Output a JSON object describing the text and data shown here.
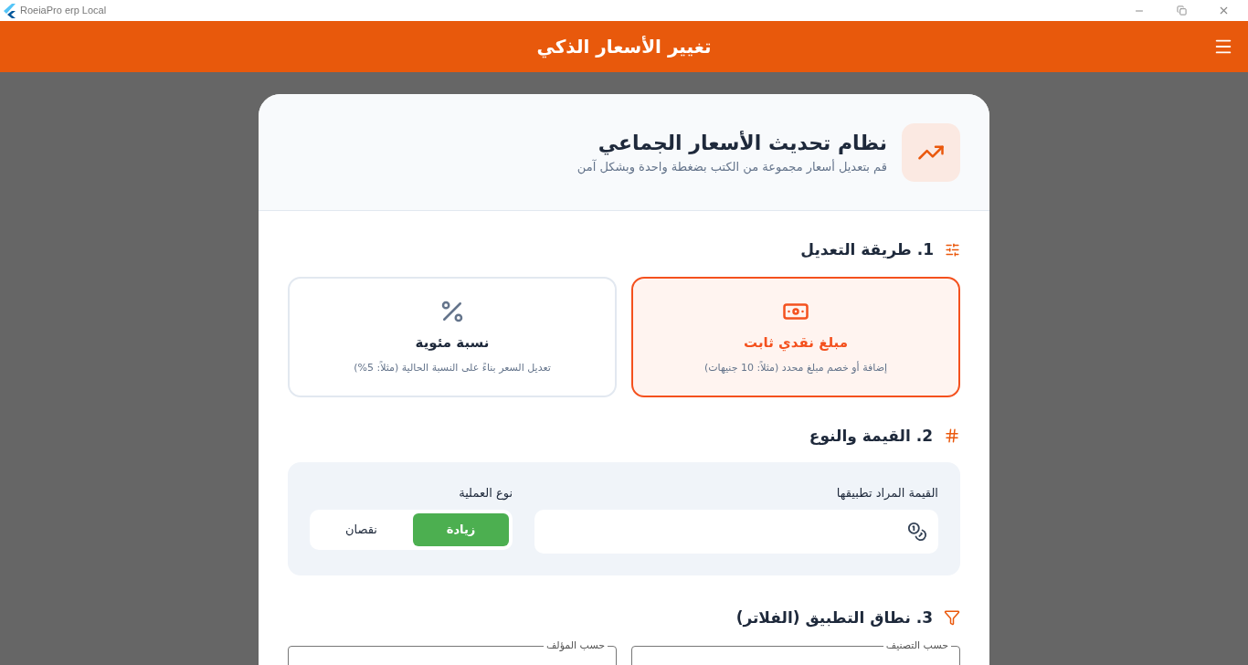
{
  "window": {
    "title": "RoeiaPro erp Local"
  },
  "app_bar": {
    "title": "تغيير الأسعار الذكي"
  },
  "header": {
    "title": "نظام تحديث الأسعار الجماعي",
    "subtitle": "قم بتعديل أسعار مجموعة من الكتب بضغطة واحدة وبشكل آمن"
  },
  "method_section": {
    "title": "1. طريقة التعديل",
    "options": [
      {
        "kind": "cash",
        "title": "مبلغ نقدي ثابت",
        "description": "إضافة أو خصم مبلغ محدد (مثلاً: 10 جنيهات)",
        "selected": true
      },
      {
        "kind": "percent",
        "title": "نسبة مئوية",
        "description": "تعديل السعر بناءً على النسبة الحالية (مثلاً: 5%)",
        "selected": false
      }
    ]
  },
  "value_section": {
    "title": "2. القيمة والنوع",
    "value_label": "القيمة المراد تطبيقها",
    "operation_label": "نوع العملية",
    "operations": [
      {
        "label": "زيادة",
        "selected": true
      },
      {
        "label": "نقصان",
        "selected": false
      }
    ]
  },
  "filter_section": {
    "title": "3. نطاق التطبيق (الفلاتر)",
    "fields": [
      {
        "label": "حسب التصنيف"
      },
      {
        "label": "حسب المؤلف"
      }
    ]
  }
}
